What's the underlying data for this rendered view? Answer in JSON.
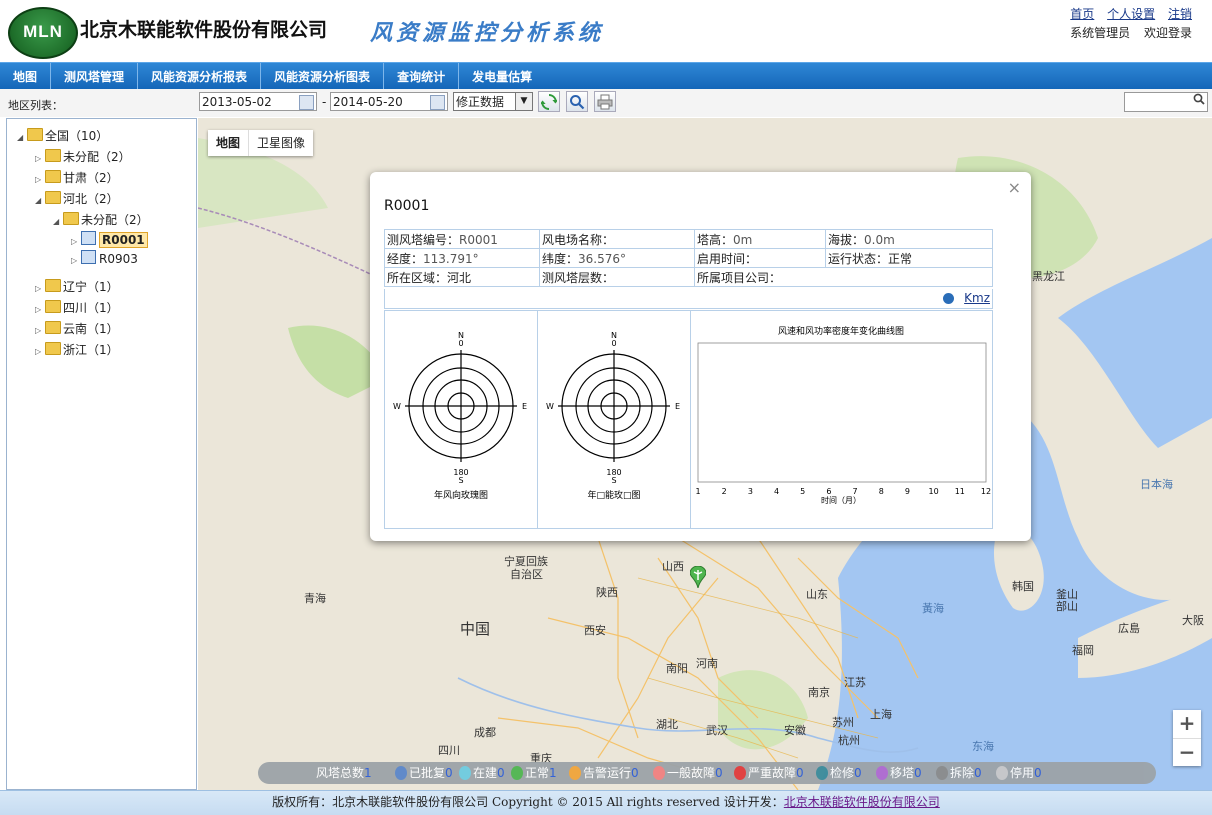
{
  "header": {
    "logo_text": "MLN",
    "company_name": "北京木联能软件股份有限公司",
    "system_title": "风资源监控分析系统",
    "links": [
      "首页",
      "个人设置",
      "注销"
    ],
    "user_role": "系统管理员",
    "welcome": "欢迎登录"
  },
  "nav": [
    "地图",
    "测风塔管理",
    "风能资源分析报表",
    "风能资源分析图表",
    "查询统计",
    "发电量估算"
  ],
  "toolbar": {
    "region_label": "地区列表：",
    "start_date": "2013-05-02",
    "separator": "-",
    "end_date": "2014-05-20",
    "data_type": "修正数据"
  },
  "tree": [
    {
      "label": "全国（10）"
    },
    {
      "label": "未分配（2）"
    },
    {
      "label": "甘肃（2）"
    },
    {
      "label": "河北（2）"
    },
    {
      "label": "未分配（2）"
    },
    {
      "label": "R0001"
    },
    {
      "label": "R0903"
    },
    {
      "label": "辽宁（1）"
    },
    {
      "label": "四川（1）"
    },
    {
      "label": "云南（1）"
    },
    {
      "label": "浙江（1）"
    }
  ],
  "map": {
    "tabs": [
      "地图",
      "卫星图像"
    ],
    "places": [
      "中国",
      "青海",
      "宁夏回族",
      "自治区",
      "山西",
      "陕西",
      "西安",
      "河南",
      "南阳",
      "山东",
      "江苏",
      "南京",
      "苏州",
      "上海",
      "杭州",
      "安徽",
      "湖北",
      "武汉",
      "四川",
      "成都",
      "重庆",
      "韩国",
      "釜山",
      "部山",
      "福岡",
      "広島",
      "大阪",
      "日本海",
      "黃海",
      "东海",
      "黑龙江"
    ],
    "zoom_in": "+",
    "zoom_out": "−"
  },
  "popup": {
    "close": "×",
    "title": "R0001",
    "rows": [
      [
        {
          "k": "测风塔编号：",
          "v": "R0001"
        },
        {
          "k": "风电场名称：",
          "v": ""
        },
        {
          "k": "塔高：",
          "v": "0m"
        },
        {
          "k": "海拔：",
          "v": "0.0m"
        }
      ],
      [
        {
          "k": "经度：",
          "v": "113.791°"
        },
        {
          "k": "纬度：",
          "v": "36.576°"
        },
        {
          "k": "启用时间：",
          "v": ""
        },
        {
          "k": "运行状态：",
          "v": "正常"
        }
      ],
      [
        {
          "k": "所在区域：",
          "v": "河北"
        },
        {
          "k": "测风塔层数：",
          "v": ""
        },
        {
          "k": "所属项目公司：",
          "v": ""
        },
        {
          "k": "",
          "v": ""
        }
      ]
    ],
    "kmz": "Kmz",
    "rose1": {
      "n": "N",
      "n_deg": "0",
      "e": "E",
      "w": "W",
      "s_deg": "180",
      "s": "S",
      "caption": "年风向玫瑰图"
    },
    "rose2": {
      "n": "N",
      "n_deg": "0",
      "e": "E",
      "w": "W",
      "s_deg": "180",
      "s": "S",
      "caption": "年□能玫□图"
    },
    "curve": {
      "title": "风速和风功率密度年变化曲线图",
      "xlabel": "时间（月）",
      "months": [
        "1",
        "2",
        "3",
        "4",
        "5",
        "6",
        "7",
        "8",
        "9",
        "10",
        "11",
        "12"
      ]
    }
  },
  "legend": {
    "total_label": "风塔总数",
    "total": "1",
    "items": [
      {
        "label": "已批复",
        "count": "0",
        "color": "#5a86c9"
      },
      {
        "label": "在建",
        "count": "0",
        "color": "#6dcbe0"
      },
      {
        "label": "正常",
        "count": "1",
        "color": "#4fb54f"
      },
      {
        "label": "告警运行",
        "count": "0",
        "color": "#f0a43a"
      },
      {
        "label": "一般故障",
        "count": "0",
        "color": "#f08080"
      },
      {
        "label": "严重故障",
        "count": "0",
        "color": "#e03a3a"
      },
      {
        "label": "检修",
        "count": "0",
        "color": "#3a8a9a"
      },
      {
        "label": "移塔",
        "count": "0",
        "color": "#b06ad0"
      },
      {
        "label": "拆除",
        "count": "0",
        "color": "#8a8a8a"
      },
      {
        "label": "停用",
        "count": "0",
        "color": "#c8c8c8"
      }
    ]
  },
  "footer": {
    "text": "版权所有：北京木联能软件股份有限公司 Copyright © 2015 All rights reserved 设计开发：",
    "link": "北京木联能软件股份有限公司"
  },
  "colors": {
    "nav_blue": "#1e73c6",
    "title_blue": "#3a7cc7",
    "marker_green": "#4fb54f"
  }
}
